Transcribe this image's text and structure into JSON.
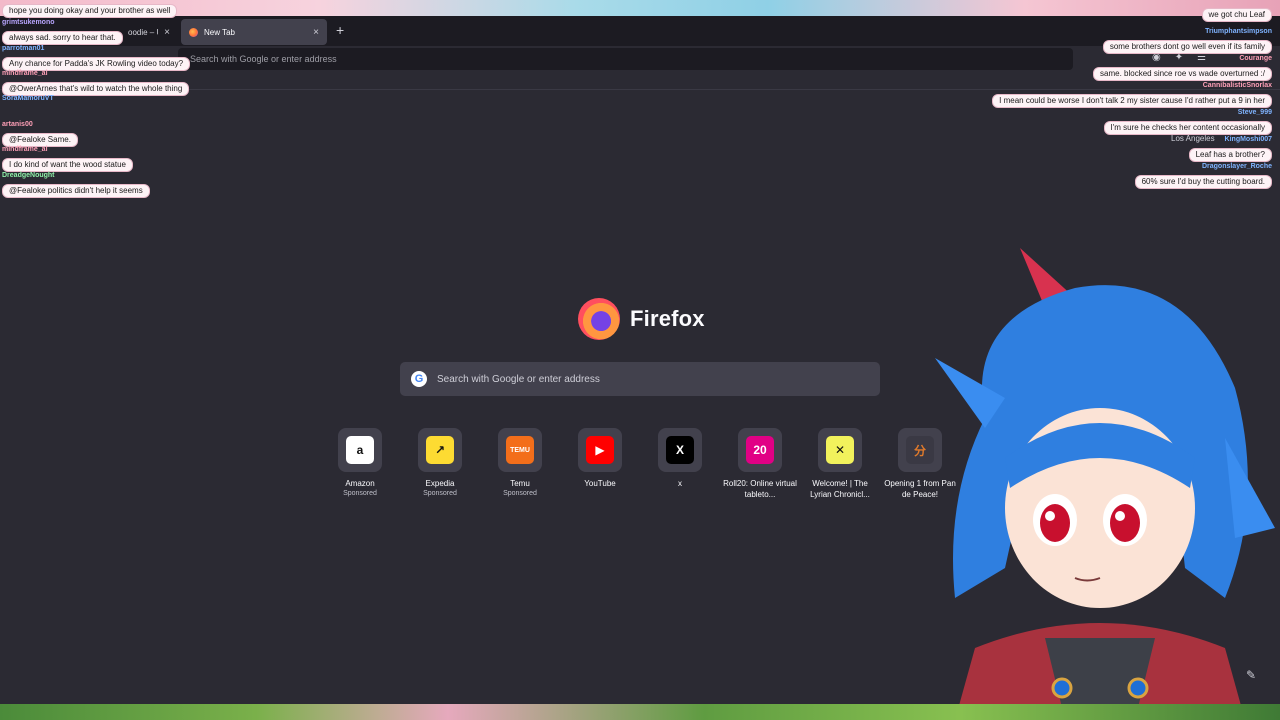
{
  "browser": {
    "tabs": [
      {
        "label": "oodie – U",
        "active": false
      },
      {
        "label": "New Tab",
        "active": true
      }
    ],
    "new_tab_symbol": "+",
    "close_symbol": "×",
    "urlbar_placeholder": "Search with Google or enter address"
  },
  "newtab": {
    "brand_name": "Firefox",
    "search_placeholder": "Search with Google or enter address",
    "shortcuts": [
      {
        "title": "Amazon",
        "sponsored": "Sponsored",
        "icon": "amazon-icon",
        "glyph": "a",
        "bg": "#ffffff",
        "fg": "#111111"
      },
      {
        "title": "Expedia",
        "sponsored": "Sponsored",
        "icon": "expedia-icon",
        "glyph": "↗",
        "bg": "#fddb32",
        "fg": "#111111"
      },
      {
        "title": "Temu",
        "sponsored": "Sponsored",
        "icon": "temu-icon",
        "glyph": "TEMU",
        "bg": "#f36e1a",
        "fg": "#ffffff"
      },
      {
        "title": "YouTube",
        "sponsored": "",
        "icon": "youtube-icon",
        "glyph": "▶",
        "bg": "#ff0000",
        "fg": "#ffffff"
      },
      {
        "title": "x",
        "sponsored": "",
        "icon": "x-icon",
        "glyph": "X",
        "bg": "#000000",
        "fg": "#ffffff"
      },
      {
        "title": "Roll20: Online virtual tableto...",
        "sponsored": "",
        "icon": "roll20-icon",
        "glyph": "20",
        "bg": "#e10085",
        "fg": "#ffffff"
      },
      {
        "title": "Welcome! | The Lyrian Chronicl...",
        "sponsored": "",
        "icon": "lyrian-icon",
        "glyph": "✕",
        "bg": "#f2f25c",
        "fg": "#111111"
      },
      {
        "title": "Opening 1 from Pan de Peace!",
        "sponsored": "",
        "icon": "pan-de-peace-icon",
        "glyph": "分",
        "bg": "#3a3944",
        "fg": "#e07a2b"
      }
    ]
  },
  "overlay": {
    "location": "Los Angeles",
    "chat_left": [
      {
        "name": "",
        "message": "hope you doing okay and your brother as well",
        "color": "#ffffff"
      },
      {
        "name": "grimtsukemono",
        "message": "always sad. sorry to hear that.",
        "color": "#b9a6ff"
      },
      {
        "name": "parrotman01",
        "message": "Any chance for Padda's JK Rowling video today?",
        "color": "#7fb3ff"
      },
      {
        "name": "mindframe_ai",
        "message": "@OwerArnes that's wild to watch the whole thing",
        "color": "#ff9fb7"
      },
      {
        "name": "SoraMamoruVT",
        "message": "",
        "color": "#7fb3ff"
      },
      {
        "name": "artanis00",
        "message": "@Fealoke Same.",
        "color": "#ff9fb7"
      },
      {
        "name": "mindframe_ai",
        "message": "I do kind of want the wood statue",
        "color": "#ff9fb7"
      },
      {
        "name": "DreadgeNought",
        "message": "@Fealoke politics didn't help it seems",
        "color": "#8ef0a8"
      }
    ],
    "chat_right": [
      {
        "name": "",
        "message": "we got chu Leaf",
        "color": "#7fb3ff"
      },
      {
        "name": "Triumphantsimpson",
        "message": "some brothers dont go well even if its family",
        "color": "#7fb3ff"
      },
      {
        "name": "Courange",
        "message": "same. blocked since roe vs wade overturned :/",
        "color": "#ff9fb7"
      },
      {
        "name": "CannibalisticSnorlax",
        "message": "I mean could be worse I don't talk 2 my sister cause I'd rather put a 9 in her",
        "color": "#ff9fb7"
      },
      {
        "name": "Steve_999",
        "message": "I'm sure he checks her content occasionally",
        "color": "#7fb3ff"
      },
      {
        "name": "KingMoshi007",
        "message": "Leaf has a brother?",
        "color": "#7fb3ff"
      },
      {
        "name": "Dragonslayer_Roche",
        "message": "60% sure I'd buy the cutting board.",
        "color": "#7fb3ff"
      }
    ]
  }
}
